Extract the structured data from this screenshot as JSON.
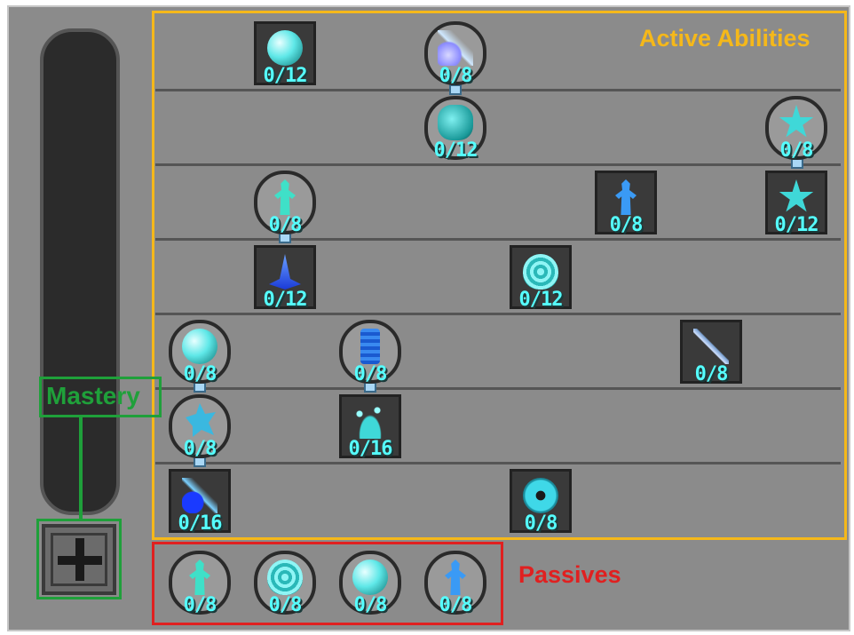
{
  "labels": {
    "active": "Active Abilities",
    "passives": "Passives",
    "mastery": "Mastery"
  },
  "colors": {
    "active_highlight": "#f5b81a",
    "passives_highlight": "#e02020",
    "mastery_highlight": "#1fa03a",
    "count_text": "#55ffff"
  },
  "active_abilities": [
    {
      "id": "r1a",
      "count": "0/12",
      "icon": "orb-icon"
    },
    {
      "id": "r1b",
      "count": "0/8",
      "icon": "comet-icon"
    },
    {
      "id": "r2a",
      "count": "0/12",
      "icon": "ice-cloud-icon"
    },
    {
      "id": "r2b",
      "count": "0/8",
      "icon": "star-shield-icon"
    },
    {
      "id": "r3a",
      "count": "0/8",
      "icon": "figure-icon"
    },
    {
      "id": "r3b",
      "count": "0/8",
      "icon": "figure-icon"
    },
    {
      "id": "r3c",
      "count": "0/12",
      "icon": "star-shield-icon"
    },
    {
      "id": "r4a",
      "count": "0/12",
      "icon": "ice-spike-icon"
    },
    {
      "id": "r4b",
      "count": "0/12",
      "icon": "vortex-egg-icon"
    },
    {
      "id": "r5a",
      "count": "0/8",
      "icon": "orb-icon"
    },
    {
      "id": "r5b",
      "count": "0/8",
      "icon": "ice-pillar-icon"
    },
    {
      "id": "r5c",
      "count": "0/8",
      "icon": "ice-sword-icon"
    },
    {
      "id": "r6a",
      "count": "0/8",
      "icon": "ice-splash-icon"
    },
    {
      "id": "r6b",
      "count": "0/16",
      "icon": "ice-shards-icon"
    },
    {
      "id": "r7a",
      "count": "0/16",
      "icon": "meteor-icon"
    },
    {
      "id": "r7b",
      "count": "0/8",
      "icon": "body-shield-icon"
    }
  ],
  "passives": [
    {
      "count": "0/8",
      "icon": "figure-icon"
    },
    {
      "count": "0/8",
      "icon": "vortex-egg-icon"
    },
    {
      "count": "0/8",
      "icon": "orb-icon"
    },
    {
      "count": "0/8",
      "icon": "figure-icon"
    }
  ],
  "mastery_button": {
    "icon": "plus-icon"
  }
}
